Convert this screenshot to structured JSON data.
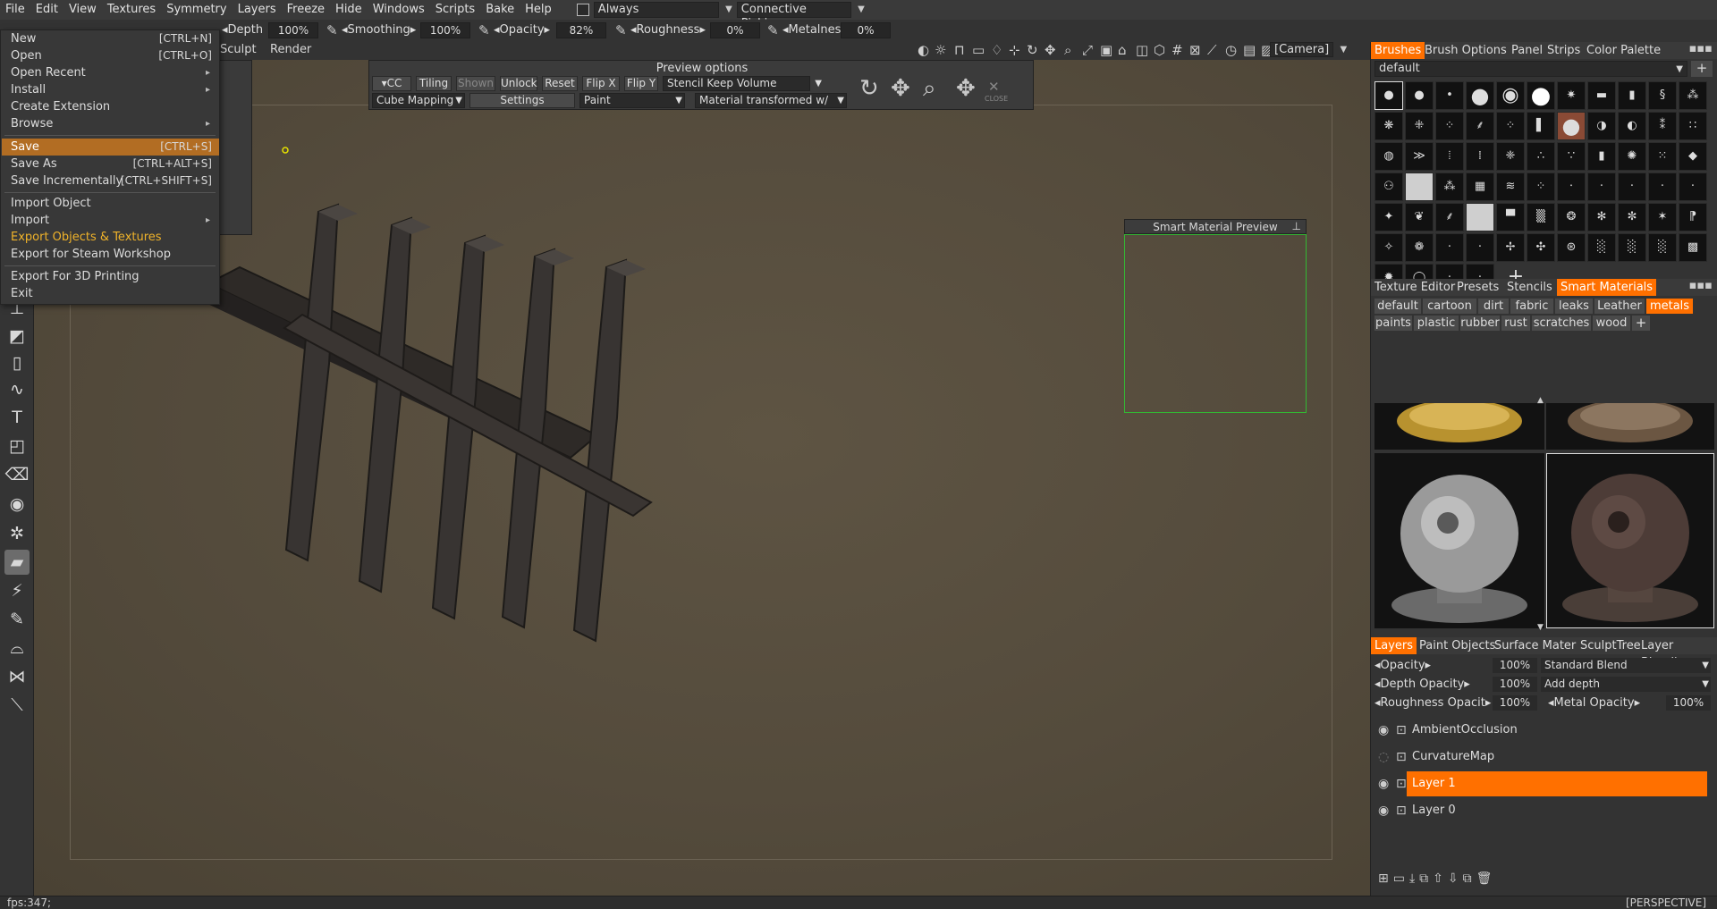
{
  "menubar": {
    "items": [
      "File",
      "Edit",
      "View",
      "Textures",
      "Symmetry",
      "Layers",
      "Freeze",
      "Hide",
      "Windows",
      "Scripts",
      "Bake",
      "Help"
    ],
    "always_label": "Always",
    "picking_label": "Connective  Picking"
  },
  "toolbar": {
    "depth_label": "Depth",
    "depth_value": "100%",
    "smoothing_label": "Smoothing",
    "smoothing_value": "100%",
    "opacity_label": "Opacity",
    "opacity_value": "82%",
    "roughness_label": "Roughness",
    "roughness_value": "0%",
    "metalness_label": "Metalness",
    "metalness_value": "0%",
    "camera_label": "[Camera]",
    "sculpt_label": "Sculpt",
    "render_label": "Render"
  },
  "file_menu": {
    "new": "New",
    "new_sc": "[CTRL+N]",
    "open": "Open",
    "open_sc": "[CTRL+O]",
    "open_recent": "Open  Recent",
    "install": "Install",
    "create_extension": "Create  Extension",
    "browse": "Browse",
    "save": "Save",
    "save_sc": "[CTRL+S]",
    "save_as": "Save  As",
    "save_as_sc": "[CTRL+ALT+S]",
    "save_incr": "Save  Incrementally",
    "save_incr_sc": "[CTRL+SHIFT+S]",
    "import_object": "Import  Object",
    "import": "Import",
    "export_obj_tex": "Export  Objects  &  Textures",
    "export_steam": "Export  for  Steam  Workshop",
    "export_3d": "Export  For  3D  Printing",
    "exit": "Exit"
  },
  "preview": {
    "title": "Preview  options",
    "cc": "CC",
    "tiling": "Tiling",
    "shown": "Shown",
    "unlock": "Unlock",
    "reset": "Reset",
    "flip_x": "Flip  X",
    "flip_y": "Flip  Y",
    "stencil_mode": "Stencil  Keep  Volume",
    "mapping": "Cube  Mapping",
    "settings": "Settings",
    "paint": "Paint",
    "material_mode": "Material  transformed  w/",
    "close": "CLOSE"
  },
  "smart_preview_title": "Smart  Material  Preview",
  "brushes_panel": {
    "tabs": [
      "Brushes",
      "Brush  Options",
      "Panel",
      "Strips",
      "Color  Palette"
    ],
    "preset": "default"
  },
  "materials_panel": {
    "tabs": [
      "Texture  Editor",
      "Presets",
      "Stencils",
      "Smart  Materials"
    ],
    "tags_row1": [
      "default",
      "cartoon",
      "dirt",
      "fabric",
      "leaks",
      "Leather",
      "metals"
    ],
    "tags_row2": [
      "paints",
      "plastic",
      "rubber",
      "rust",
      "scratches",
      "wood"
    ]
  },
  "layers_panel": {
    "tabs": [
      "Layers",
      "Paint  Objects",
      "Surface  Mater",
      "SculptTree",
      "Layer  Blendin"
    ],
    "opacity_label": "Opacity",
    "opacity_value": "100%",
    "blend": "Standard  Blend",
    "depth_opacity_label": "Depth  Opacity",
    "depth_opacity_value": "100%",
    "depth_mode": "Add  depth",
    "rough_opacity_label": "Roughness  Opacit",
    "rough_opacity_value": "100%",
    "metal_opacity_label": "Metal  Opacity",
    "metal_opacity_value": "100%",
    "layers": [
      "AmbientOcclusion",
      "CurvatureMap",
      "Layer  1",
      "Layer  0"
    ]
  },
  "status": {
    "fps": "fps:347;",
    "view": "[PERSPECTIVE]"
  },
  "colors": {
    "accent": "#ff7000",
    "menu_highlight": "#b26d23",
    "export_highlight": "#f0b32a",
    "preview_border": "#33b833"
  }
}
